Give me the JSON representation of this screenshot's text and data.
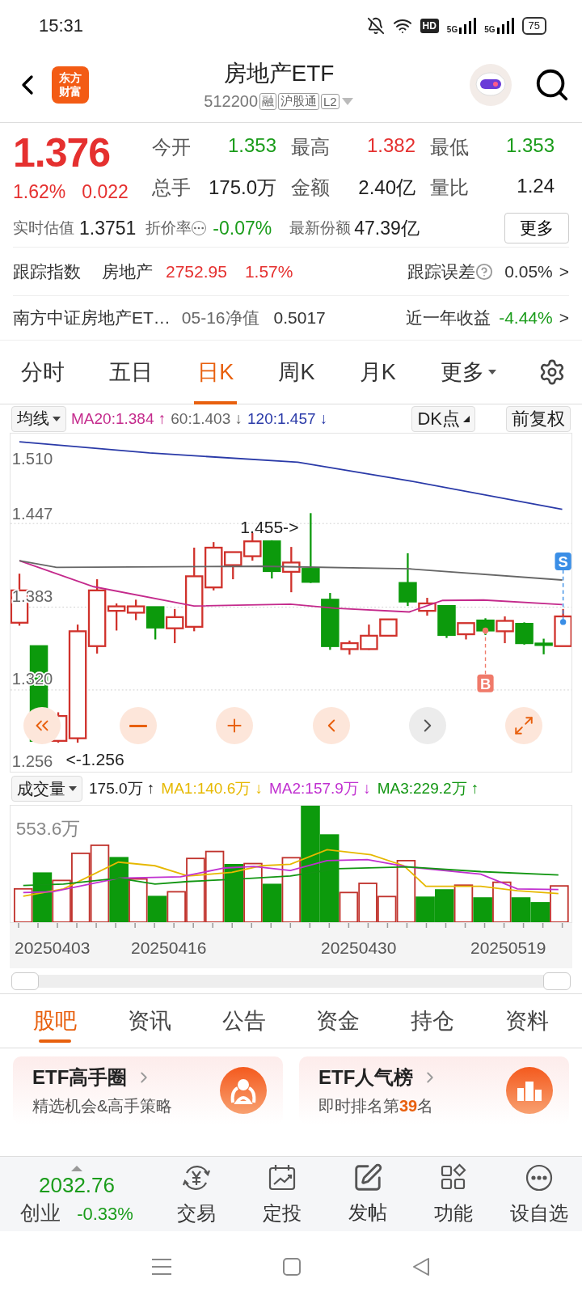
{
  "status_bar": {
    "time": "15:31",
    "hd": "HD",
    "signals": [
      "5G",
      "5G"
    ],
    "battery": "75"
  },
  "header": {
    "logo": [
      "东方",
      "财富"
    ],
    "title": "房地产ETF",
    "code": "512200",
    "tags": [
      "融",
      "沪股通",
      "L2"
    ]
  },
  "quote": {
    "price": "1.376",
    "change_pct": "1.62%",
    "change": "0.022",
    "color": "#e5302f",
    "stats": [
      {
        "label": "今开",
        "value": "1.353",
        "color": "#1a9c1a"
      },
      {
        "label": "最高",
        "value": "1.382",
        "color": "#e5302f"
      },
      {
        "label": "最低",
        "value": "1.353",
        "color": "#1a9c1a"
      },
      {
        "label": "总手",
        "value": "175.0万",
        "color": "#222222"
      },
      {
        "label": "金额",
        "value": "2.40亿",
        "color": "#222222"
      },
      {
        "label": "量比",
        "value": "1.24",
        "color": "#222222"
      }
    ],
    "estimate": {
      "label": "实时估值",
      "value": "1.3751"
    },
    "discount": {
      "label": "折价率",
      "value": "-0.07%",
      "color": "#1a9c1a"
    },
    "shares": {
      "label": "最新份额",
      "value": "47.39亿"
    },
    "more_button": "更多"
  },
  "tracking": {
    "label": "跟踪指数",
    "index": "房地产",
    "value": "2752.95",
    "change": "1.57%",
    "color": "#e5302f",
    "error_label": "跟踪误差",
    "error_value": "0.05%",
    "arrow": ">"
  },
  "fund": {
    "name": "南方中证房地产ET…",
    "nav_label": "05-16净值",
    "nav": "0.5017",
    "return_label": "近一年收益",
    "return": "-4.44%",
    "color": "#1a9c1a",
    "arrow": ">"
  },
  "chart_tabs": [
    {
      "label": "分时",
      "selected": false,
      "kind": "tab"
    },
    {
      "label": "五日",
      "selected": false,
      "kind": "tab"
    },
    {
      "label": "日K",
      "selected": true,
      "kind": "tab"
    },
    {
      "label": "周K",
      "selected": false,
      "kind": "tab"
    },
    {
      "label": "月K",
      "selected": false,
      "kind": "tab"
    },
    {
      "label": "更多",
      "selected": false,
      "kind": "menu"
    }
  ],
  "kline": {
    "ma_button": "均线",
    "ma_legend": [
      {
        "text": "MA20:1.384 ↑",
        "color": "#c42a8c"
      },
      {
        "text": "60:1.403 ↓",
        "color": "#666666"
      },
      {
        "text": "120:1.457 ↓",
        "color": "#2a3aa8"
      }
    ],
    "dk_button": "DK点",
    "adjust_button": "前复权",
    "y_axis": [
      "1.510",
      "1.447",
      "1.383",
      "1.320",
      "1.256"
    ],
    "high_label": "1.455->",
    "low_label": "<-1.256",
    "markers": [
      {
        "label": "S",
        "kind": "sell"
      },
      {
        "label": "B",
        "kind": "buy"
      }
    ],
    "controls": [
      {
        "kind": "first",
        "disabled": false
      },
      {
        "kind": "zoom_out",
        "disabled": false
      },
      {
        "kind": "zoom_in",
        "disabled": false
      },
      {
        "kind": "prev",
        "disabled": false
      },
      {
        "kind": "next",
        "disabled": true
      },
      {
        "kind": "fullscreen",
        "disabled": false
      }
    ]
  },
  "volume": {
    "button": "成交量",
    "legend": [
      {
        "text": "175.0万 ↑",
        "color": "#222222"
      },
      {
        "text": "MA1:140.6万 ↓",
        "color": "#e6b800"
      },
      {
        "text": "MA2:157.9万 ↓",
        "color": "#c030d0"
      },
      {
        "text": "MA3:229.2万 ↑",
        "color": "#129612"
      }
    ],
    "max_label": "553.6万",
    "dates": [
      "20250403",
      "20250416",
      "20250430",
      "20250519"
    ]
  },
  "content_tabs": [
    {
      "label": "股吧",
      "selected": true
    },
    {
      "label": "资讯",
      "selected": false
    },
    {
      "label": "公告",
      "selected": false
    },
    {
      "label": "资金",
      "selected": false
    },
    {
      "label": "持仓",
      "selected": false
    },
    {
      "label": "资料",
      "selected": false
    }
  ],
  "cards": [
    {
      "title": "ETF高手圈",
      "subtitle": "精选机会&高手策略",
      "kind": "circle"
    },
    {
      "title": "ETF人气榜",
      "subtitle": "即时排名第**39**名",
      "kind": "ranking"
    }
  ],
  "bottom_nav": {
    "index": {
      "value": "2032.76",
      "name": "创业",
      "change": "-0.33%",
      "color": "#1a9c1a"
    },
    "items": [
      {
        "label": "交易",
        "kind": "trade"
      },
      {
        "label": "定投",
        "kind": "invest"
      },
      {
        "label": "发帖",
        "kind": "post"
      },
      {
        "label": "功能",
        "kind": "apps"
      },
      {
        "label": "设自选",
        "kind": "more"
      }
    ]
  }
}
